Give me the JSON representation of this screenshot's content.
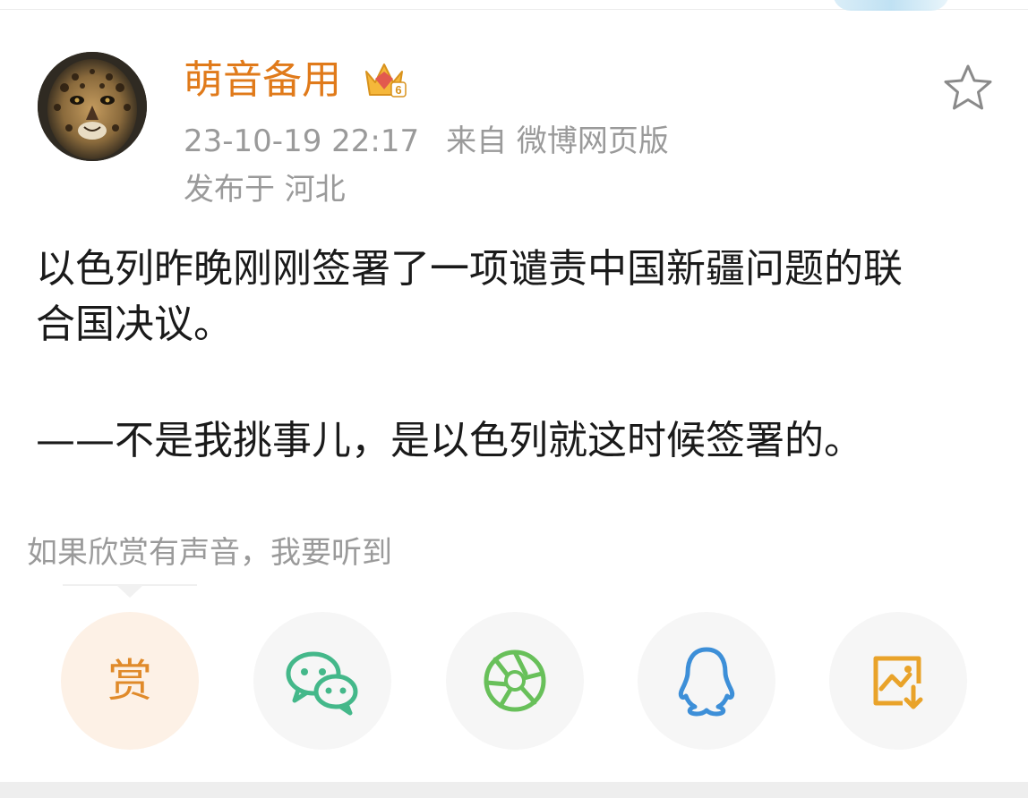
{
  "post": {
    "username": "萌音备用",
    "meta": {
      "datetime": "23-10-19 22:17",
      "source": "来自 微博网页版",
      "location": "发布于 河北"
    },
    "content": {
      "line1": "以色列昨晚刚刚签署了一项谴责中国新疆问题的联",
      "line2": "合国决议。",
      "line3": "——不是我挑事儿，是以色列就这时候签署的。"
    }
  },
  "reward": {
    "prompt": "如果欣赏有声音，我要听到",
    "button_label": "赏"
  },
  "share_actions": [
    {
      "icon": "reward-icon"
    },
    {
      "icon": "wechat-icon"
    },
    {
      "icon": "moments-icon"
    },
    {
      "icon": "qq-icon"
    },
    {
      "icon": "save-image-icon"
    }
  ],
  "colors": {
    "username": "#e07a1a",
    "meta_text": "#9a9a9a",
    "reward_bg": "#fdf1e6",
    "reward_text": "#e08a2a",
    "wechat": "#44b88a",
    "moments": "#68c05a",
    "qq": "#3d8fd8",
    "save": "#e9a32a"
  }
}
